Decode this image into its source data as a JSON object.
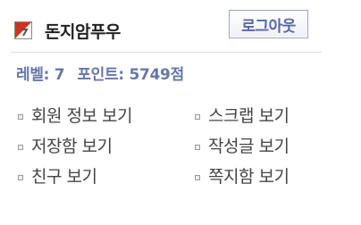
{
  "header": {
    "username": "돈지암푸우",
    "logout_label": "로그아웃",
    "icon": "user-badge-icon"
  },
  "stats": {
    "level_text": "레벨: 7",
    "points_text": "포인트: 5749점"
  },
  "links": [
    {
      "label": "회원 정보 보기"
    },
    {
      "label": "스크랩 보기"
    },
    {
      "label": "저장함 보기"
    },
    {
      "label": "작성글 보기"
    },
    {
      "label": "친구 보기"
    },
    {
      "label": "쪽지함 보기"
    }
  ],
  "colors": {
    "accent": "#6677aa",
    "button_border": "#9aa3c8",
    "icon_red": "#cc3322"
  }
}
